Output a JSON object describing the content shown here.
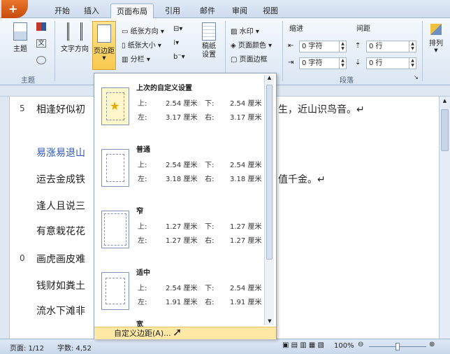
{
  "tabs": [
    "开始",
    "插入",
    "页面布局",
    "引用",
    "邮件",
    "审阅",
    "视图"
  ],
  "active_tab": "页面布局",
  "ribbon": {
    "theme_group": {
      "label": "主题",
      "theme_button": "主题"
    },
    "page_setup": {
      "text_direction": "文字方向",
      "margins": "页边距",
      "orientation": "纸张方向",
      "size": "纸张大小",
      "columns": "分栏",
      "draft_paper": "稿纸\n设置"
    },
    "background": {
      "watermark": "水印",
      "page_color": "页面颜色",
      "page_border": "页面边框"
    },
    "paragraph": {
      "indent_label": "缩进",
      "spacing_label": "间距",
      "indent_left": "0 字符",
      "indent_right": "0 字符",
      "spacing_before": "0 行",
      "spacing_after": "0 行",
      "group_label": "段落"
    },
    "arrange": "排列"
  },
  "margins_dropdown": {
    "presets": [
      {
        "name": "上次的自定义设置",
        "top": "2.54 厘米",
        "bottom": "2.54 厘米",
        "left": "3.17 厘米",
        "right": "3.17 厘米",
        "selected": true
      },
      {
        "name": "普通",
        "top": "2.54 厘米",
        "bottom": "2.54 厘米",
        "left": "3.18 厘米",
        "right": "3.18 厘米",
        "selected": false
      },
      {
        "name": "窄",
        "top": "1.27 厘米",
        "bottom": "1.27 厘米",
        "left": "1.27 厘米",
        "right": "1.27 厘米",
        "selected": false
      },
      {
        "name": "适中",
        "top": "2.54 厘米",
        "bottom": "2.54 厘米",
        "left": "1.91 厘米",
        "right": "1.91 厘米",
        "selected": false
      },
      {
        "name": "宽"
      }
    ],
    "labels": {
      "top": "上:",
      "bottom": "下:",
      "left": "左:",
      "right": "右:"
    },
    "custom": "自定义边距(A)..."
  },
  "document": {
    "lines": [
      {
        "num": "5",
        "text": "相逢好似初",
        "rest": "生，近山识鸟音。↵",
        "style": "normal"
      },
      {
        "num": "",
        "text": "易涨易退山",
        "rest": "",
        "style": "blue"
      },
      {
        "num": "",
        "text": "运去金成铁",
        "rest": "值千金。↵",
        "style": "normal"
      },
      {
        "num": "",
        "text": "逢人且说三",
        "rest": "",
        "style": "normal"
      },
      {
        "num": "",
        "text": "有意栽花花",
        "rest": "",
        "style": "normal"
      },
      {
        "num": "0",
        "text": "画虎画皮难",
        "rest": "",
        "style": "normal"
      },
      {
        "num": "",
        "text": "钱财如粪土",
        "rest": "",
        "style": "normal"
      },
      {
        "num": "",
        "text": "流水下滩非",
        "rest": "",
        "style": "normal"
      }
    ]
  },
  "status": {
    "page": "页面: 1/12",
    "words": "字数: 4,52",
    "zoom": "100%"
  }
}
